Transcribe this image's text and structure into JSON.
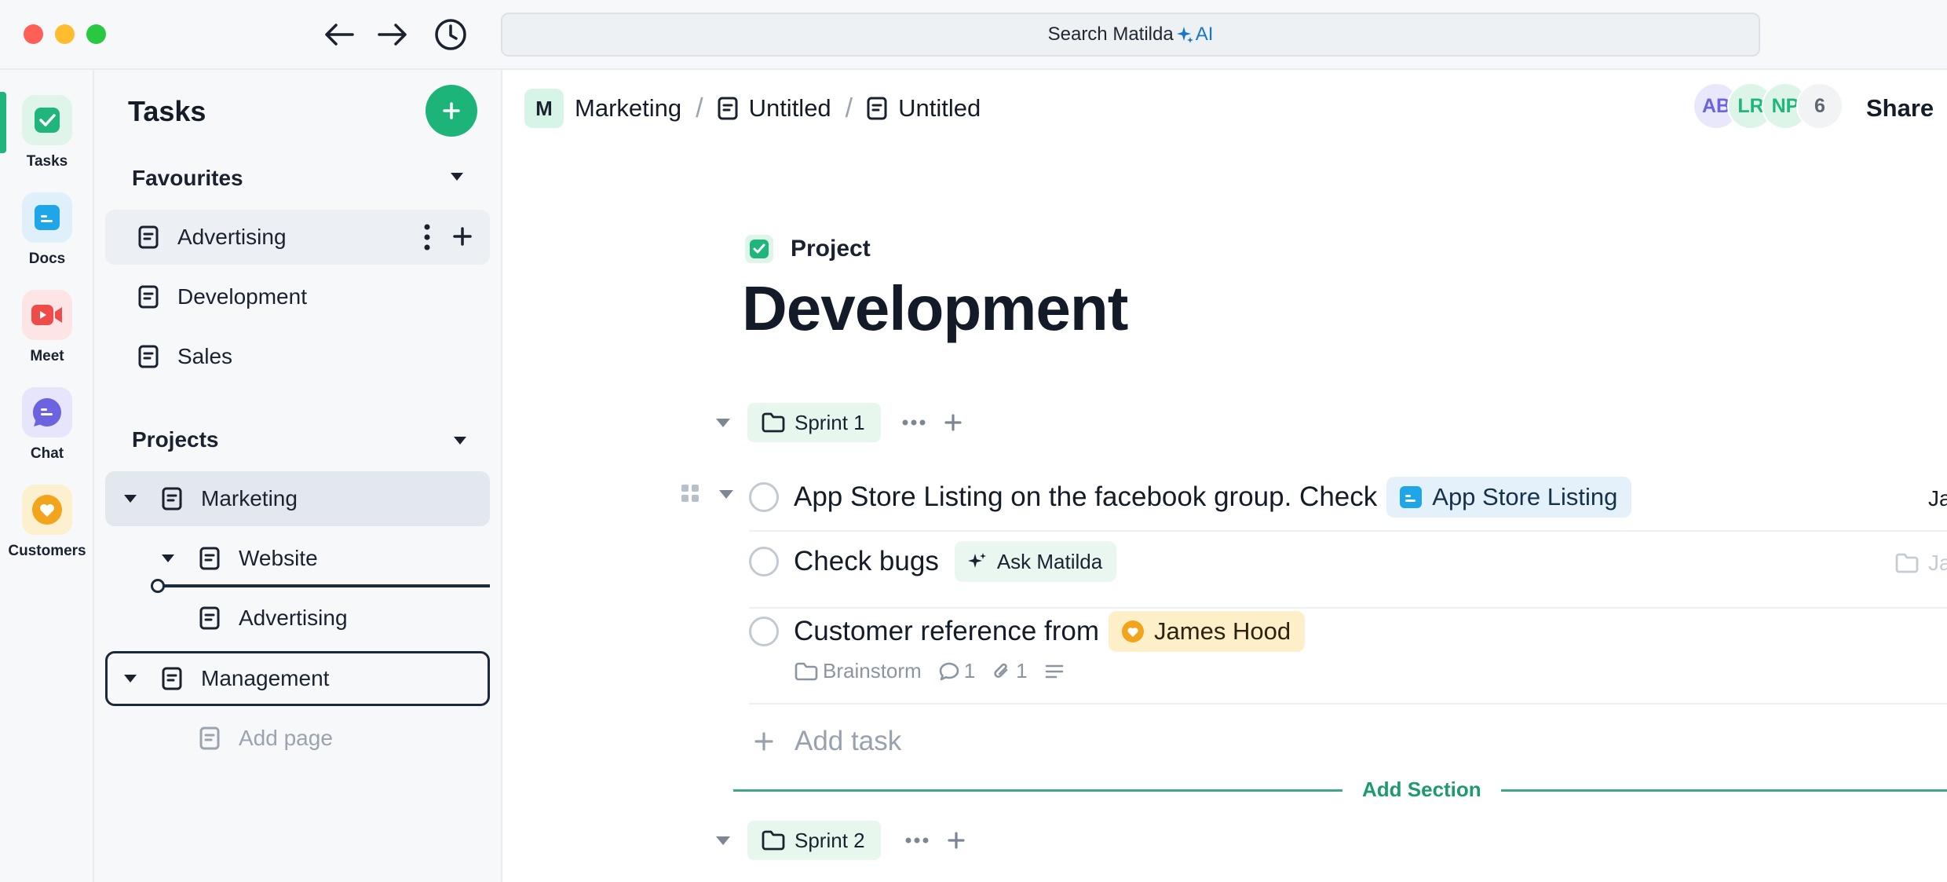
{
  "titlebar": {
    "search_label": "Search Matilda",
    "search_ai_label": "AI"
  },
  "rail": {
    "items": [
      {
        "label": "Tasks",
        "icon": "tasks-icon",
        "color": "#1fb57b",
        "bg": "#dff5ea"
      },
      {
        "label": "Docs",
        "icon": "docs-icon",
        "color": "#1ea6e8",
        "bg": "#dff0fb"
      },
      {
        "label": "Meet",
        "icon": "video-icon",
        "color": "#ee4b4b",
        "bg": "#fde5e5"
      },
      {
        "label": "Chat",
        "icon": "chat-icon",
        "color": "#6b63e0",
        "bg": "#e6e5fb"
      },
      {
        "label": "Customers",
        "icon": "heart-icon",
        "color": "#f2a41c",
        "bg": "#fdf0cf"
      }
    ]
  },
  "sidebar": {
    "title": "Tasks",
    "favourites_label": "Favourites",
    "favourites": [
      {
        "label": "Advertising"
      },
      {
        "label": "Development"
      },
      {
        "label": "Sales"
      }
    ],
    "projects_label": "Projects",
    "projects": [
      {
        "label": "Marketing"
      },
      {
        "label": "Website"
      },
      {
        "label": "Advertising"
      },
      {
        "label": "Management"
      }
    ],
    "add_page_label": "Add page"
  },
  "header": {
    "workspace_badge": "M",
    "crumbs": [
      "Marketing",
      "Untitled",
      "Untitled"
    ],
    "avatars": [
      {
        "initials": "AB",
        "bg": "#e9e8fb",
        "fg": "#6b63e0"
      },
      {
        "initials": "LR",
        "bg": "#dcf5e8",
        "fg": "#1fb57b"
      },
      {
        "initials": "NP",
        "bg": "#dcf5e8",
        "fg": "#1fb57b"
      },
      {
        "initials": "6",
        "bg": "#f1f3f5",
        "fg": "#5d6773"
      }
    ],
    "share_label": "Share"
  },
  "page": {
    "type_label": "Project",
    "title": "Development"
  },
  "sections": [
    {
      "label": "Sprint 1"
    },
    {
      "label": "Sprint 2"
    }
  ],
  "tasks": [
    {
      "text": "App Store Listing on the facebook group. Check",
      "chip": "App Store Listing",
      "date": "Jan"
    },
    {
      "text": "Check bugs",
      "chip": "Ask Matilda",
      "date": "Jan"
    },
    {
      "text": "Customer reference from",
      "chip": "James Hood",
      "meta_folder": "Brainstorm",
      "meta_comments": "1",
      "meta_attachments": "1"
    }
  ],
  "add_task_label": "Add task",
  "add_section_label": "Add Section",
  "colors": {
    "accent": "#1db47a",
    "link": "#1677c9"
  }
}
